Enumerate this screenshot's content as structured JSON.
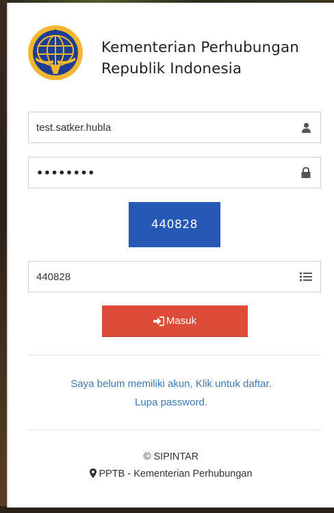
{
  "header": {
    "title_line1": "Kementerian Perhubungan",
    "title_line2": "Republik Indonesia"
  },
  "form": {
    "username_value": "test.satker.hubla",
    "password_masked": "••••••••",
    "captcha_text": "440828",
    "captcha_input_value": "440828",
    "submit_label": "Masuk"
  },
  "links": {
    "register": "Saya belum memiliki akun, Klik untuk daftar.",
    "forgot_password": "Lupa password."
  },
  "footer": {
    "app_name": "© SIPINTAR",
    "org": "PPTB - Kementerian Perhubungan"
  },
  "icons": {
    "username": "user-icon",
    "password": "lock-icon",
    "captcha": "list-icon",
    "submit": "sign-in-icon",
    "footer": "map-marker-icon"
  },
  "colors": {
    "captcha_bg": "#2559b5",
    "button_bg": "#dd4b39",
    "link": "#3c78b4",
    "logo_blue": "#1e3f8f",
    "logo_gold": "#f2b632"
  }
}
